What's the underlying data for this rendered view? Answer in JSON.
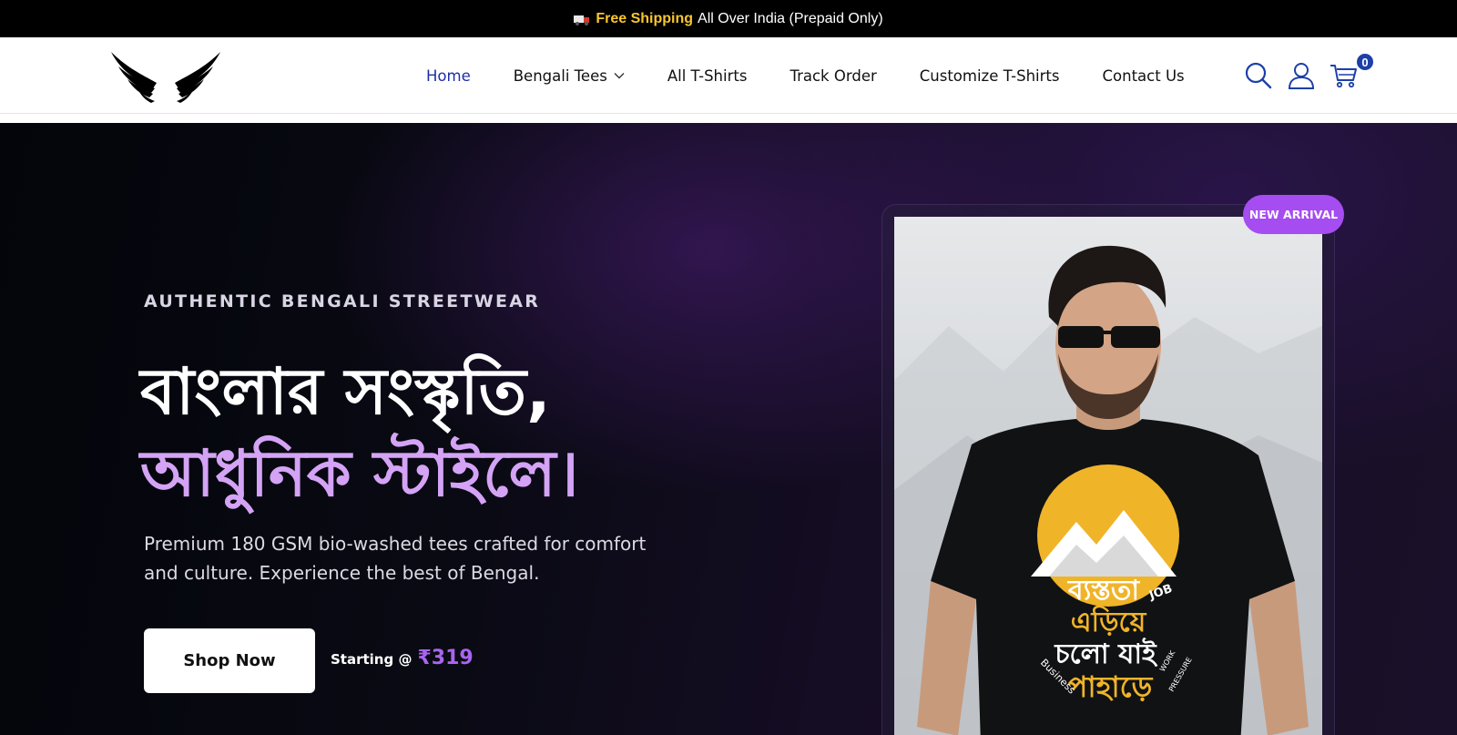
{
  "announcement": {
    "free_text": "Free Shipping",
    "rest_text": "All Over India (Prepaid Only)"
  },
  "header": {
    "nav": [
      {
        "label": "Home",
        "active": true
      },
      {
        "label": "Bengali Tees",
        "has_dropdown": true
      },
      {
        "label": "All T-Shirts"
      },
      {
        "label": "Track Order"
      },
      {
        "label": "Customize T-Shirts"
      },
      {
        "label": "Contact Us"
      }
    ],
    "cart_count": "0"
  },
  "hero": {
    "eyebrow": "AUTHENTIC BENGALI STREETWEAR",
    "headline_line1": "বাংলার সংস্কৃতি,",
    "headline_line2": "আধুনিক স্টাইলে।",
    "description": "Premium 180 GSM bio-washed tees crafted for comfort and culture. Experience the best of Bengal.",
    "cta_label": "Shop Now",
    "price_label": "Starting @",
    "price_value": "₹319"
  },
  "product": {
    "badge": "NEW ARRIVAL",
    "tee_print": {
      "line1": "ব্যস্ততা",
      "line2": "এড়িয়ে",
      "line3": "চলো যাই",
      "line4": "পাহাড়ে",
      "word_job": "JOB",
      "word_business": "Business",
      "word_work": "WORK",
      "word_pressure": "PRESSURE"
    }
  },
  "colors": {
    "accent_purple": "#a54df0",
    "headline_purple": "#d4a3f5",
    "nav_active": "#1d2fa8",
    "shipping_yellow": "#f7c62f"
  }
}
